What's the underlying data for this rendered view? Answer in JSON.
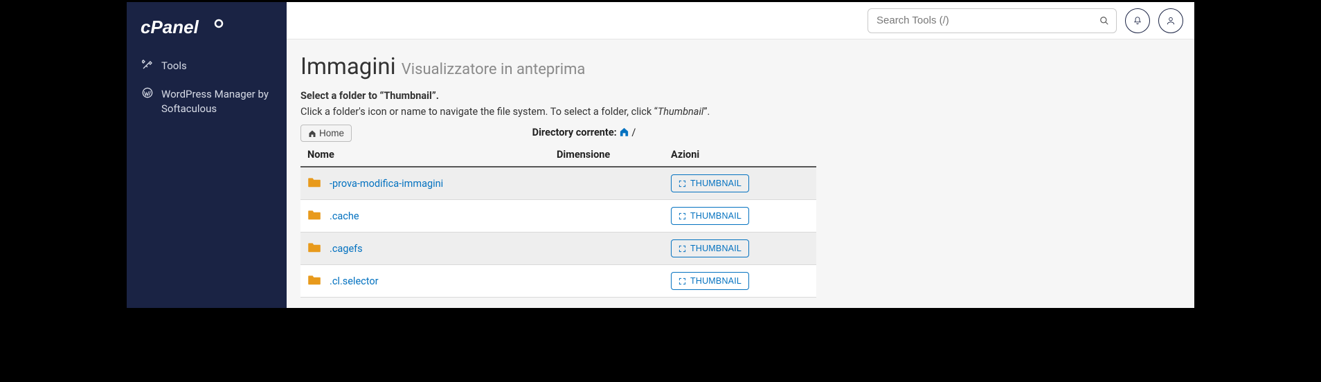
{
  "brand": "cPanel",
  "sidebar": {
    "items": [
      {
        "icon": "tools-icon",
        "label": "Tools"
      },
      {
        "icon": "wordpress-icon",
        "label": "WordPress Manager by Softaculous"
      }
    ]
  },
  "topbar": {
    "search_placeholder": "Search Tools (/)"
  },
  "page": {
    "title": "Immagini",
    "subtitle": "Visualizzatore in anteprima",
    "instruction_head": "Select a folder to “Thumbnail”.",
    "instruction_body_pre": "Click a folder's icon or name to navigate the file system. To select a folder, click “",
    "instruction_body_em": "Thumbnail",
    "instruction_body_post": "”.",
    "home_label": "Home",
    "current_dir_label": "Directory corrente:",
    "slash": "/"
  },
  "table": {
    "headers": {
      "name": "Nome",
      "size": "Dimensione",
      "actions": "Azioni"
    },
    "rows": [
      {
        "name": "-prova-modifica-immagini",
        "action": "THUMBNAIL"
      },
      {
        "name": ".cache",
        "action": "THUMBNAIL"
      },
      {
        "name": ".cagefs",
        "action": "THUMBNAIL"
      },
      {
        "name": ".cl.selector",
        "action": "THUMBNAIL"
      }
    ]
  }
}
